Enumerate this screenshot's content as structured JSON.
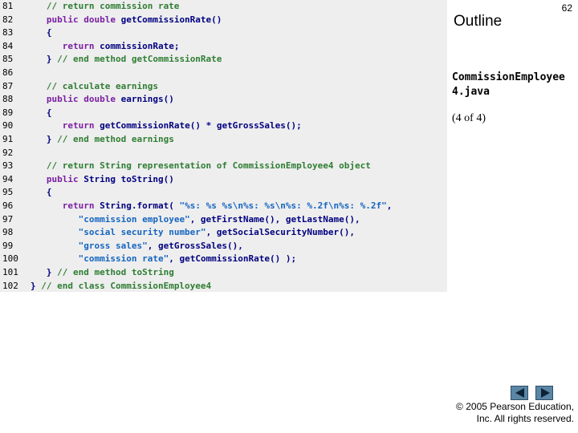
{
  "code": {
    "lines": [
      {
        "num": "81",
        "parts": [
          {
            "t": "   // return commission rate",
            "c": "cm"
          }
        ]
      },
      {
        "num": "82",
        "parts": [
          {
            "t": "   ",
            "c": ""
          },
          {
            "t": "public double",
            "c": "kw"
          },
          {
            "t": " getCommissionRate()",
            "c": ""
          }
        ]
      },
      {
        "num": "83",
        "parts": [
          {
            "t": "   {",
            "c": ""
          }
        ]
      },
      {
        "num": "84",
        "parts": [
          {
            "t": "      ",
            "c": ""
          },
          {
            "t": "return",
            "c": "kw"
          },
          {
            "t": " commissionRate;",
            "c": ""
          }
        ]
      },
      {
        "num": "85",
        "parts": [
          {
            "t": "   } ",
            "c": ""
          },
          {
            "t": "// end method getCommissionRate",
            "c": "cm"
          }
        ]
      },
      {
        "num": "86",
        "parts": []
      },
      {
        "num": "87",
        "parts": [
          {
            "t": "   // calculate earnings",
            "c": "cm"
          }
        ]
      },
      {
        "num": "88",
        "parts": [
          {
            "t": "   ",
            "c": ""
          },
          {
            "t": "public double",
            "c": "kw"
          },
          {
            "t": " earnings()",
            "c": ""
          }
        ]
      },
      {
        "num": "89",
        "parts": [
          {
            "t": "   {",
            "c": ""
          }
        ]
      },
      {
        "num": "90",
        "parts": [
          {
            "t": "      ",
            "c": ""
          },
          {
            "t": "return",
            "c": "kw"
          },
          {
            "t": " getCommissionRate() * getGrossSales();",
            "c": ""
          }
        ]
      },
      {
        "num": "91",
        "parts": [
          {
            "t": "   } ",
            "c": ""
          },
          {
            "t": "// end method earnings",
            "c": "cm"
          }
        ]
      },
      {
        "num": "92",
        "parts": []
      },
      {
        "num": "93",
        "parts": [
          {
            "t": "   // return String representation of CommissionEmployee4 object",
            "c": "cm"
          }
        ]
      },
      {
        "num": "94",
        "parts": [
          {
            "t": "   ",
            "c": ""
          },
          {
            "t": "public",
            "c": "kw"
          },
          {
            "t": " String toString()",
            "c": ""
          }
        ]
      },
      {
        "num": "95",
        "parts": [
          {
            "t": "   {",
            "c": ""
          }
        ]
      },
      {
        "num": "96",
        "parts": [
          {
            "t": "      ",
            "c": ""
          },
          {
            "t": "return",
            "c": "kw"
          },
          {
            "t": " String.format( ",
            "c": ""
          },
          {
            "t": "\"%s: %s %s\\n%s: %s\\n%s: %.2f\\n%s: %.2f\"",
            "c": "st"
          },
          {
            "t": ",",
            "c": ""
          }
        ]
      },
      {
        "num": "97",
        "parts": [
          {
            "t": "         ",
            "c": ""
          },
          {
            "t": "\"commission employee\"",
            "c": "st"
          },
          {
            "t": ", getFirstName(), getLastName(),",
            "c": ""
          }
        ]
      },
      {
        "num": "98",
        "parts": [
          {
            "t": "         ",
            "c": ""
          },
          {
            "t": "\"social security number\"",
            "c": "st"
          },
          {
            "t": ", getSocialSecurityNumber(),",
            "c": ""
          }
        ]
      },
      {
        "num": "99",
        "parts": [
          {
            "t": "         ",
            "c": ""
          },
          {
            "t": "\"gross sales\"",
            "c": "st"
          },
          {
            "t": ", getGrossSales(),",
            "c": ""
          }
        ]
      },
      {
        "num": "100",
        "parts": [
          {
            "t": "         ",
            "c": ""
          },
          {
            "t": "\"commission rate\"",
            "c": "st"
          },
          {
            "t": ", getCommissionRate() );",
            "c": ""
          }
        ]
      },
      {
        "num": "101",
        "parts": [
          {
            "t": "   } ",
            "c": ""
          },
          {
            "t": "// end method toString",
            "c": "cm"
          }
        ]
      },
      {
        "num": "102",
        "parts": [
          {
            "t": "} ",
            "c": ""
          },
          {
            "t": "// end class CommissionEmployee4",
            "c": "cm"
          }
        ]
      }
    ]
  },
  "sidebar": {
    "outline": "Outline",
    "slide_number": "62",
    "filename_line1": "CommissionEmployee",
    "filename_line2": "4.java",
    "page_info": "(4 of 4)"
  },
  "nav": {
    "prev_icon": "triangle-left-icon",
    "next_icon": "triangle-right-icon",
    "button_color": "#5b86a6"
  },
  "footer": {
    "copyright_line1": "© 2005 Pearson Education,",
    "copyright_line2": "Inc.  All rights reserved."
  }
}
